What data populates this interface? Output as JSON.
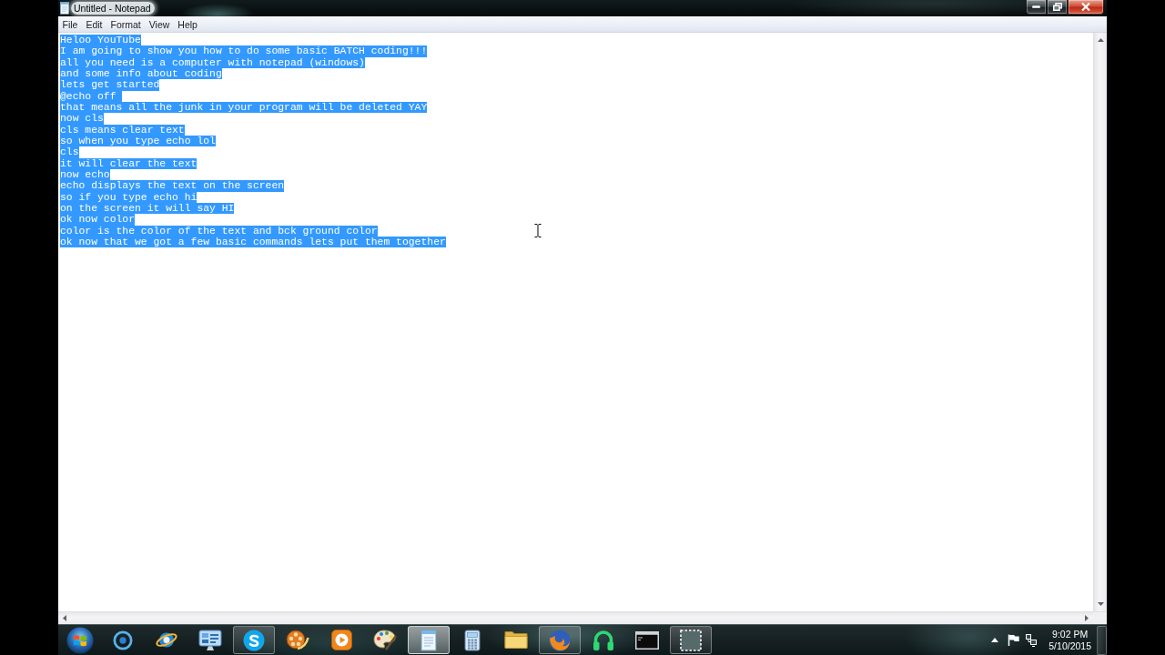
{
  "window": {
    "title": "Untitled - Notepad"
  },
  "menu": [
    "File",
    "Edit",
    "Format",
    "View",
    "Help"
  ],
  "editor": {
    "selected": true,
    "lines": [
      "Heloo YouTube",
      "I am going to show you how to do some basic BATCH coding!!!",
      "all you need is a computer with notepad (windows)",
      "and some info about coding",
      "lets get started",
      "@echo off ",
      "that means all the junk in your program will be deleted YAY",
      "now cls",
      "cls means clear text",
      "so when you type echo lol",
      "cls",
      "it will clear the text",
      "now echo",
      "echo displays the text on the screen",
      "so if you type echo hi",
      "on the screen it will say HI",
      "ok now color",
      "color is the color of the text and bck ground color",
      "ok now that we got a few basic commands lets put them together"
    ]
  },
  "taskbar": {
    "items": [
      {
        "kind": "ring",
        "running": false,
        "active": false
      },
      {
        "kind": "globe",
        "running": false,
        "active": false
      },
      {
        "kind": "dashboard",
        "running": false,
        "active": false
      },
      {
        "kind": "chat",
        "running": true,
        "active": false
      },
      {
        "kind": "film",
        "running": false,
        "active": false
      },
      {
        "kind": "player",
        "running": false,
        "active": false
      },
      {
        "kind": "palette",
        "running": false,
        "active": false
      },
      {
        "kind": "notepad",
        "running": true,
        "active": true
      },
      {
        "kind": "calculator",
        "running": false,
        "active": false
      },
      {
        "kind": "folder",
        "running": false,
        "active": false
      },
      {
        "kind": "fox",
        "running": true,
        "active": false
      },
      {
        "kind": "headphones",
        "running": false,
        "active": false
      },
      {
        "kind": "terminal",
        "running": false,
        "active": false
      },
      {
        "kind": "snip",
        "running": true,
        "active": false
      }
    ],
    "clock": {
      "time": "9:02 PM",
      "date": "5/10/2015"
    }
  }
}
